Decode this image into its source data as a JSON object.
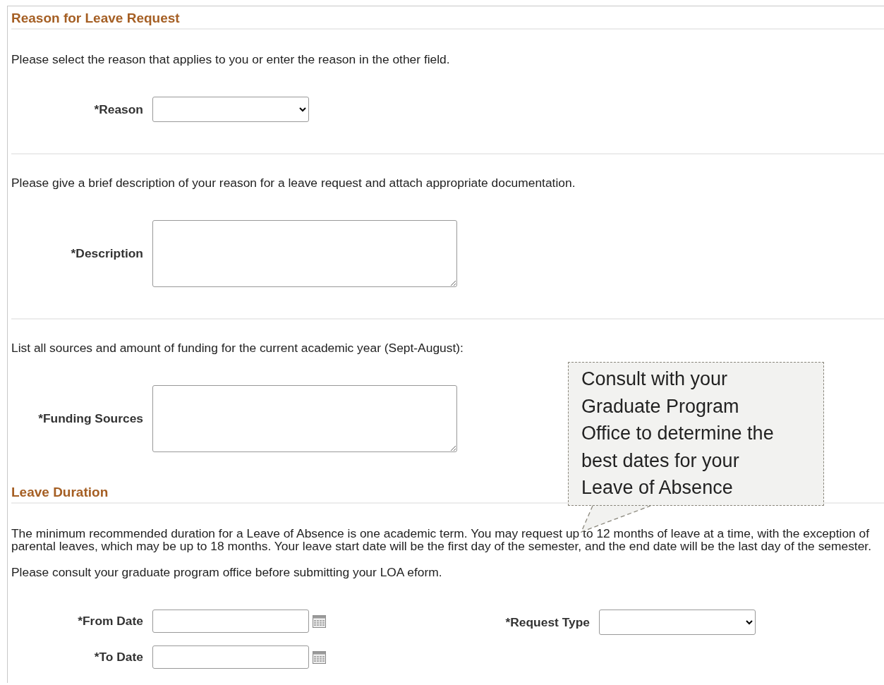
{
  "blocks": [
    {
      "kind": "heading",
      "text": "Reason for Leave Request"
    },
    {
      "kind": "text",
      "text": "Please select the reason that applies to you or enter the reason in the other field."
    },
    {
      "kind": "fields",
      "left": [
        {
          "kind": "select",
          "label": "*Reason"
        }
      ]
    },
    {
      "kind": "divider"
    },
    {
      "kind": "text",
      "text": "Please give a brief description of your reason for a leave request and attach appropriate documentation."
    },
    {
      "kind": "fields",
      "left": [
        {
          "kind": "textarea",
          "label": "*Description"
        }
      ]
    },
    {
      "kind": "divider"
    },
    {
      "kind": "text",
      "text": "List all sources and amount of funding for the current academic year (Sept-August):"
    },
    {
      "kind": "fields",
      "left": [
        {
          "kind": "textarea",
          "label": "*Funding Sources"
        }
      ]
    },
    {
      "kind": "heading",
      "text": "Leave Duration"
    },
    {
      "kind": "text",
      "text": "The minimum recommended duration for a Leave of Absence is one academic term. You may request up to 12 months of leave at a time, with the exception of parental leaves, which may be up to 18 months. Your leave start date will be the first day of the semester, and the end date will be the last day of the semester."
    },
    {
      "kind": "text",
      "text": "Please consult your graduate program office before submitting your LOA eform."
    },
    {
      "kind": "fields",
      "left": [
        {
          "kind": "date",
          "label": "*From Date"
        },
        {
          "kind": "date",
          "label": "*To Date"
        }
      ],
      "right": [
        {
          "kind": "select",
          "label": "*Request Type"
        }
      ]
    }
  ],
  "callout": {
    "lines": [
      "Consult with your",
      "Graduate Program",
      "Office to determine the",
      "best dates for your",
      "Leave of Absence"
    ]
  }
}
